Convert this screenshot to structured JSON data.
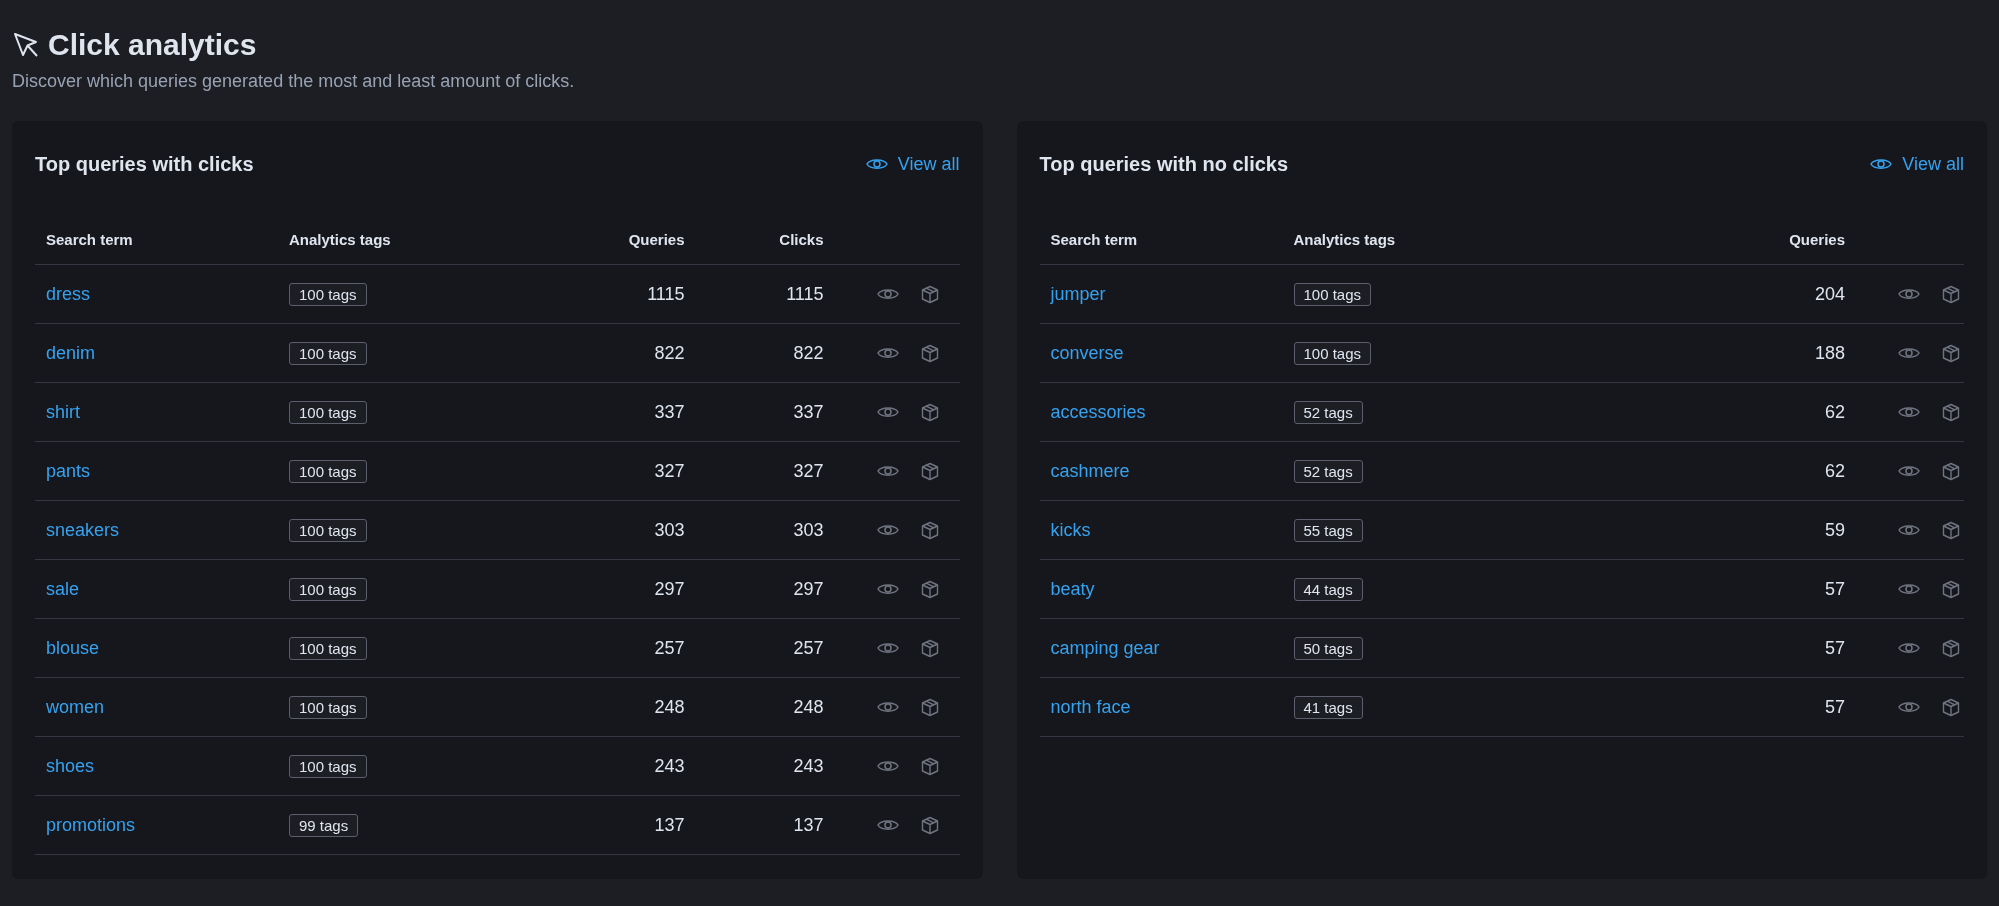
{
  "header": {
    "title": "Click analytics",
    "subtitle": "Discover which queries generated the most and least amount of clicks."
  },
  "panels": [
    {
      "title": "Top queries with clicks",
      "view_all": "View all",
      "columns": [
        {
          "label": "Search term",
          "kind": "term"
        },
        {
          "label": "Analytics tags",
          "kind": "tags"
        },
        {
          "label": "Queries",
          "kind": "queries"
        },
        {
          "label": "Clicks",
          "kind": "clicks"
        },
        {
          "kind": "actions"
        }
      ],
      "rows": [
        {
          "term": "dress",
          "tags": "100 tags",
          "queries": "1115",
          "clicks": "1115"
        },
        {
          "term": "denim",
          "tags": "100 tags",
          "queries": "822",
          "clicks": "822"
        },
        {
          "term": "shirt",
          "tags": "100 tags",
          "queries": "337",
          "clicks": "337"
        },
        {
          "term": "pants",
          "tags": "100 tags",
          "queries": "327",
          "clicks": "327"
        },
        {
          "term": "sneakers",
          "tags": "100 tags",
          "queries": "303",
          "clicks": "303"
        },
        {
          "term": "sale",
          "tags": "100 tags",
          "queries": "297",
          "clicks": "297"
        },
        {
          "term": "blouse",
          "tags": "100 tags",
          "queries": "257",
          "clicks": "257"
        },
        {
          "term": "women",
          "tags": "100 tags",
          "queries": "248",
          "clicks": "248"
        },
        {
          "term": "shoes",
          "tags": "100 tags",
          "queries": "243",
          "clicks": "243"
        },
        {
          "term": "promotions",
          "tags": "99 tags",
          "queries": "137",
          "clicks": "137"
        }
      ]
    },
    {
      "title": "Top queries with no clicks",
      "view_all": "View all",
      "columns": [
        {
          "label": "Search term",
          "kind": "term"
        },
        {
          "label": "Analytics tags",
          "kind": "tags"
        },
        {
          "label": "Queries",
          "kind": "queries"
        },
        {
          "kind": "actions"
        }
      ],
      "rows": [
        {
          "term": "jumper",
          "tags": "100 tags",
          "queries": "204"
        },
        {
          "term": "converse",
          "tags": "100 tags",
          "queries": "188"
        },
        {
          "term": "accessories",
          "tags": "52 tags",
          "queries": "62"
        },
        {
          "term": "cashmere",
          "tags": "52 tags",
          "queries": "62"
        },
        {
          "term": "kicks",
          "tags": "55 tags",
          "queries": "59"
        },
        {
          "term": "beaty",
          "tags": "44 tags",
          "queries": "57"
        },
        {
          "term": "camping gear",
          "tags": "50 tags",
          "queries": "57"
        },
        {
          "term": "north face",
          "tags": "41 tags",
          "queries": "57"
        }
      ]
    }
  ]
}
